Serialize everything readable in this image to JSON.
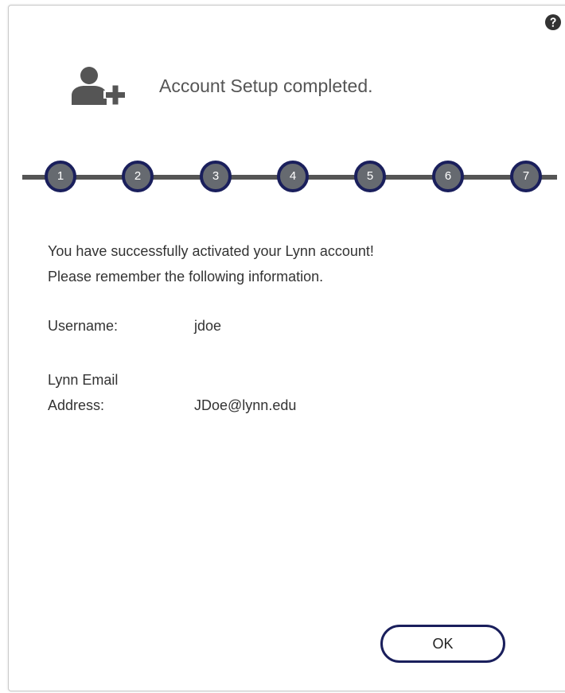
{
  "header": {
    "title": "Account Setup completed.",
    "icon": "user-plus-icon",
    "help_icon": "question-circle-icon"
  },
  "stepper": {
    "steps": [
      "1",
      "2",
      "3",
      "4",
      "5",
      "6",
      "7"
    ]
  },
  "message": {
    "line1": "You have successfully activated your Lynn account!",
    "line2": "Please remember the following information."
  },
  "info": {
    "username_label": "Username:",
    "username_value": "jdoe",
    "email_label_line1": "Lynn Email",
    "email_label_line2": "Address:",
    "email_value": "JDoe@lynn.edu"
  },
  "actions": {
    "ok_label": "OK"
  },
  "colors": {
    "accent": "#1a1f5c",
    "step_fill": "#666a70",
    "icon_gray": "#555555",
    "text": "#333333"
  }
}
